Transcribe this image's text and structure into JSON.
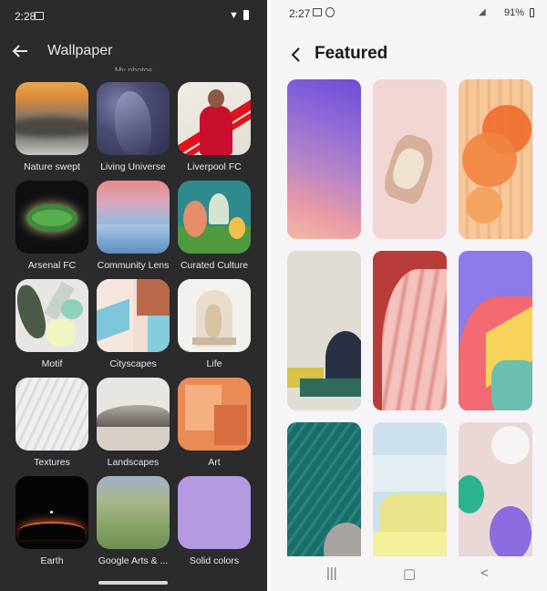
{
  "left_phone": {
    "status": {
      "time": "2:28"
    },
    "header": {
      "title": "Wallpaper"
    },
    "subtitle": "My photos",
    "categories": [
      "Nature swept",
      "Living Universe",
      "Liverpool FC",
      "Arsenal FC",
      "Community Lens",
      "Curated Culture",
      "Motif",
      "Cityscapes",
      "Life",
      "Textures",
      "Landscapes",
      "Art",
      "Earth",
      "Google Arts & ...",
      "Solid colors"
    ]
  },
  "right_phone": {
    "status": {
      "time": "2:27",
      "battery": "91%"
    },
    "header": {
      "title": "Featured"
    },
    "wallpaper_count": 9
  }
}
